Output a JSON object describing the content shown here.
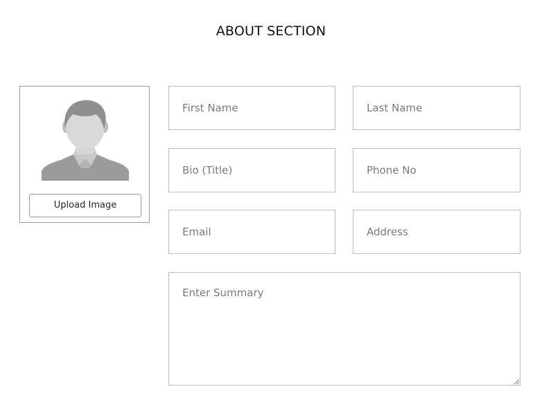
{
  "header": {
    "title": "ABOUT SECTION"
  },
  "profile": {
    "avatar_icon": "user-silhouette-icon",
    "upload_label": "Upload Image"
  },
  "form": {
    "first_name": {
      "value": "",
      "placeholder": "First Name"
    },
    "last_name": {
      "value": "",
      "placeholder": "Last Name"
    },
    "bio_title": {
      "value": "",
      "placeholder": "Bio (Title)"
    },
    "phone": {
      "value": "",
      "placeholder": "Phone No"
    },
    "email": {
      "value": "",
      "placeholder": "Email"
    },
    "address": {
      "value": "",
      "placeholder": "Address"
    },
    "summary": {
      "value": "",
      "placeholder": "Enter Summary"
    }
  },
  "colors": {
    "border": "#bdbdbd",
    "placeholder": "#7a7a7a",
    "avatar_gray": "#9b9b9b"
  }
}
